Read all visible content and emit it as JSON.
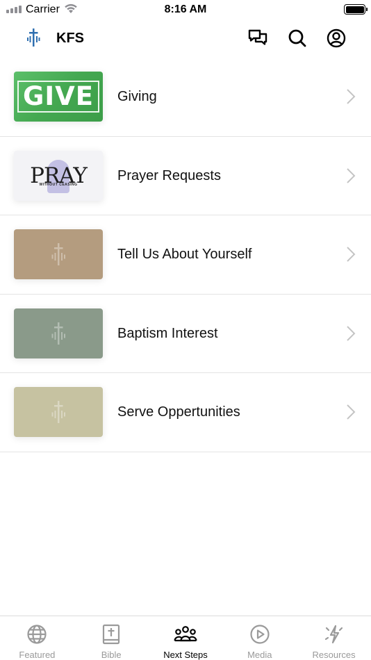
{
  "status_bar": {
    "carrier": "Carrier",
    "time": "8:16 AM"
  },
  "header": {
    "title": "KFS",
    "logo_icon": "cross-waveform-logo",
    "brand_color": "#2f6fb0",
    "actions": [
      "chat-icon",
      "search-icon",
      "account-icon"
    ]
  },
  "list": {
    "items": [
      {
        "label": "Giving",
        "thumb_text": "GIVE",
        "thumb_color": "#4caf5a"
      },
      {
        "label": "Prayer Requests",
        "thumb_text": "PRAY",
        "thumb_subtext": "WITHOUT CEASING",
        "thumb_color": "#f3f3f6"
      },
      {
        "label": "Tell Us About Yourself",
        "thumb_color": "#b49c7f"
      },
      {
        "label": "Baptism Interest",
        "thumb_color": "#8a9a8a"
      },
      {
        "label": "Serve Oppertunities",
        "thumb_color": "#c6c2a1"
      }
    ]
  },
  "tabbar": {
    "active_color": "#000000",
    "inactive_color": "#9a9a9a",
    "tabs": [
      {
        "label": "Featured",
        "icon": "globe-icon",
        "active": false
      },
      {
        "label": "Bible",
        "icon": "bible-icon",
        "active": false
      },
      {
        "label": "Next Steps",
        "icon": "people-icon",
        "active": true
      },
      {
        "label": "Media",
        "icon": "play-icon",
        "active": false
      },
      {
        "label": "Resources",
        "icon": "sparkle-icon",
        "active": false
      }
    ]
  }
}
